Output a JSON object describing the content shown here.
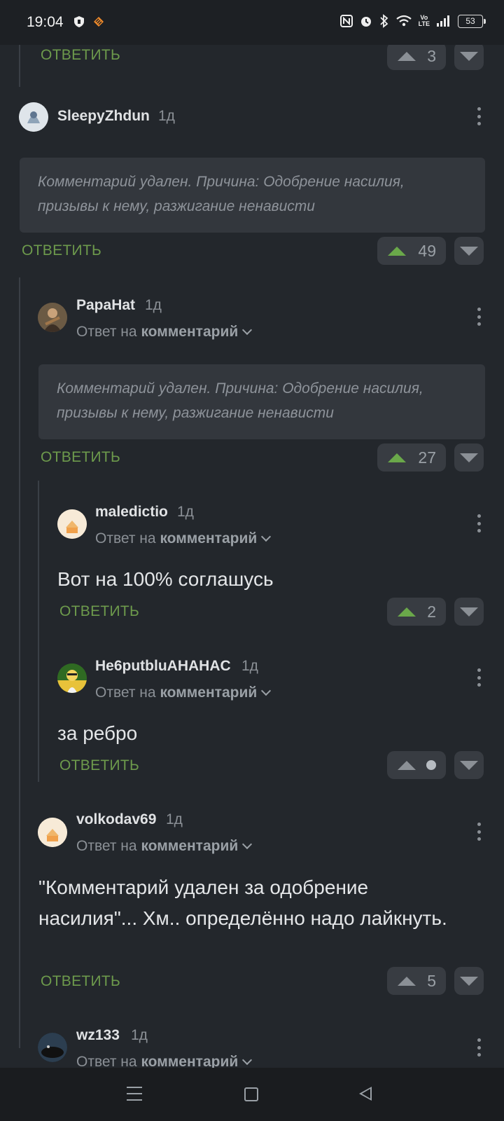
{
  "status_bar": {
    "time": "19:04",
    "battery": "53"
  },
  "reply_label": "ОТВЕТИТЬ",
  "reply_to_prefix": "Ответ на",
  "reply_to_target": "комментарий",
  "top_partial": {
    "votes": "3"
  },
  "comments": [
    {
      "user": "SleepyZhdun",
      "time": "1д",
      "deleted_text": "Комментарий удален. Причина: Одобрение насилия, призывы к нему, разжигание ненависти",
      "votes": "49"
    },
    {
      "user": "PapaHat",
      "time": "1д",
      "deleted_text": "Комментарий удален. Причина: Одобрение насилия, призывы к нему, разжигание ненависти",
      "votes": "27"
    },
    {
      "user": "maledictio",
      "time": "1д",
      "text": "Вот на 100% соглашусь",
      "votes": "2"
    },
    {
      "user": "He6putbluAHAHAC",
      "time": "1д",
      "text": "за ребро",
      "votes": ""
    },
    {
      "user": "volkodav69",
      "time": "1д",
      "text": "\"Комментарий удален за одобрение насилия\"... Хм.. определённо надо лайкнуть.",
      "votes": "5"
    },
    {
      "user": "wz133",
      "time": "1д"
    }
  ],
  "colors": {
    "accent_green": "#6d9a4c",
    "background": "#23272c"
  }
}
